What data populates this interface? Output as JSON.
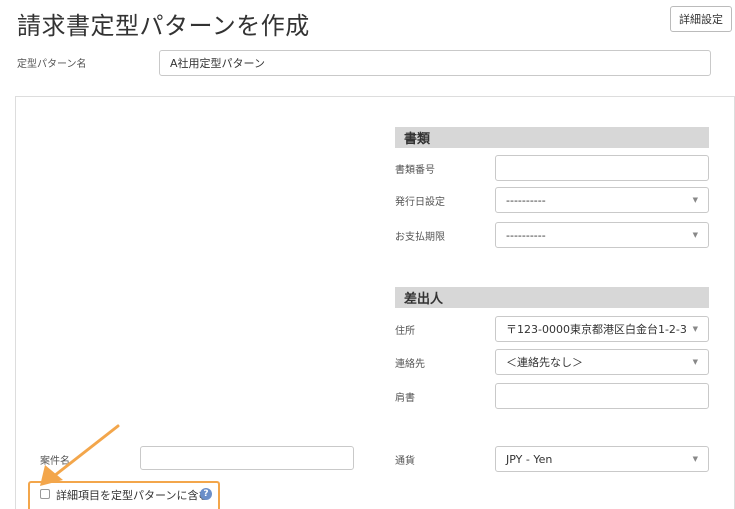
{
  "page": {
    "title": "請求書定型パターンを作成",
    "detail_settings_button": "詳細設定"
  },
  "pattern": {
    "label": "定型パターン名",
    "value": "A社用定型パターン"
  },
  "documents": {
    "heading": "書類",
    "doc_number_label": "書類番号",
    "doc_number_value": "",
    "issue_date_label": "発行日設定",
    "issue_date_value": "----------",
    "due_date_label": "お支払期限",
    "due_date_value": "----------"
  },
  "sender": {
    "heading": "差出人",
    "address_label": "住所",
    "address_value": "〒123-0000東京都港区白金台1-2-3",
    "contact_label": "連絡先",
    "contact_value": "＜連絡先なし＞",
    "title_label": "肩書",
    "title_value": ""
  },
  "project": {
    "label": "案件名",
    "value": ""
  },
  "currency": {
    "label": "通貨",
    "value": "JPY - Yen"
  },
  "include_details": {
    "label": "詳細項目を定型パターンに含む",
    "help": "?",
    "checked": false
  },
  "colors": {
    "highlight": "#f3a64b",
    "section_bg": "#d7d7d7",
    "help_icon": "#6b8fc9"
  }
}
